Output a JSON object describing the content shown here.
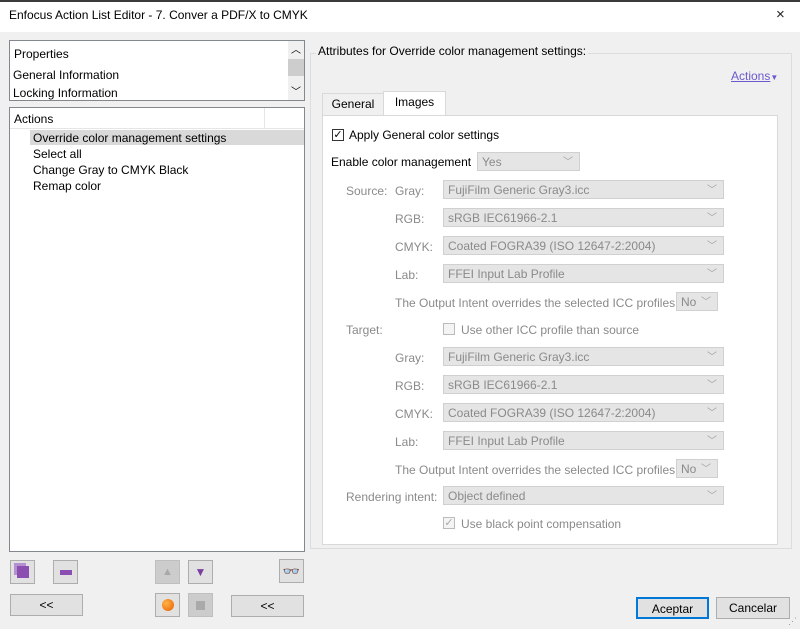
{
  "window": {
    "title": "Enfocus Action List Editor - 7. Conver a PDF/X to CMYK",
    "close": "×"
  },
  "properties": {
    "items": [
      "Properties",
      "General Information",
      "Locking Information"
    ]
  },
  "actions": {
    "header": "Actions",
    "items": [
      "Override color management settings",
      "Select all",
      "Change Gray to CMYK Black",
      "Remap color"
    ],
    "selected": 0
  },
  "left_buttons": {
    "back1": "<<",
    "back2": "<<"
  },
  "right": {
    "group_title": "Attributes for Override color management settings:",
    "actions_link": "Actions",
    "tabs": [
      {
        "label": "General",
        "active": false
      },
      {
        "label": "Images",
        "active": true
      }
    ],
    "apply_general": {
      "label": "Apply General color settings",
      "checked": true
    },
    "enable": {
      "label": "Enable color management",
      "value": "Yes"
    },
    "source": {
      "label": "Source:",
      "gray_label": "Gray:",
      "gray": "FujiFilm Generic Gray3.icc",
      "rgb_label": "RGB:",
      "rgb": "sRGB IEC61966-2.1",
      "cmyk_label": "CMYK:",
      "cmyk": "Coated FOGRA39 (ISO 12647-2:2004)",
      "lab_label": "Lab:",
      "lab": "FFEI Input Lab Profile",
      "oi_label": "The Output Intent overrides the selected ICC profiles",
      "oi": "No"
    },
    "target": {
      "label": "Target:",
      "use_other": {
        "label": "Use other ICC profile than source",
        "checked": false
      },
      "gray_label": "Gray:",
      "gray": "FujiFilm Generic Gray3.icc",
      "rgb_label": "RGB:",
      "rgb": "sRGB IEC61966-2.1",
      "cmyk_label": "CMYK:",
      "cmyk": "Coated FOGRA39 (ISO 12647-2:2004)",
      "lab_label": "Lab:",
      "lab": "FFEI Input Lab Profile",
      "oi_label": "The Output Intent overrides the selected ICC profiles",
      "oi": "No"
    },
    "rendering": {
      "label": "Rendering intent:",
      "value": "Object defined"
    },
    "bpc": {
      "label": "Use black point compensation",
      "checked": true
    }
  },
  "footer": {
    "ok": "Aceptar",
    "cancel": "Cancelar"
  }
}
